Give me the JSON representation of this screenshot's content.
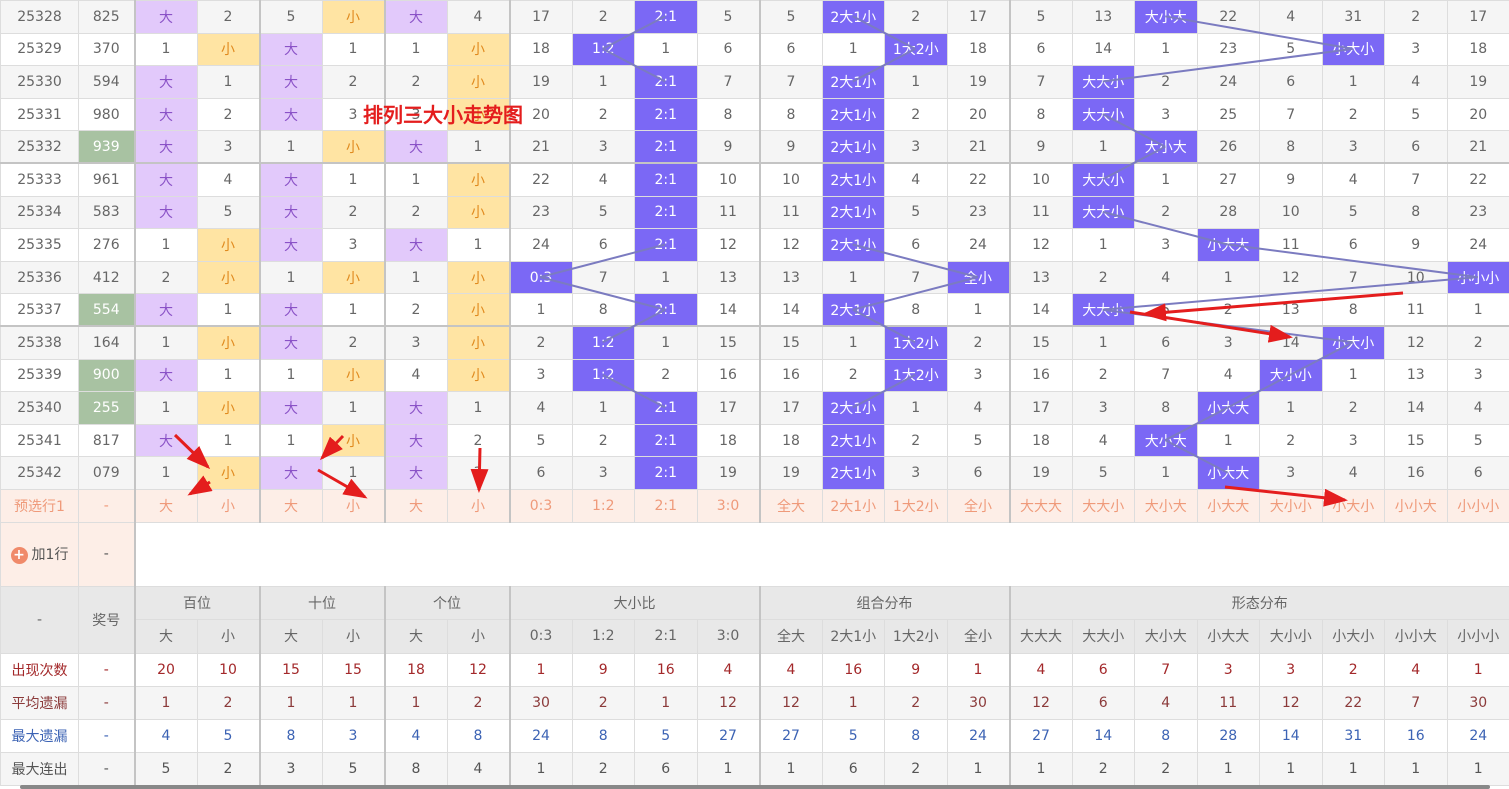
{
  "title_overlay": "排列三大小走势图",
  "colors": {
    "big": "#e2c9fb",
    "small": "#ffe4a3",
    "pattern": "#7b68f5",
    "hot_number": "#a8c2a2",
    "line": "#7b7bc0",
    "arrow": "#e41d1d"
  },
  "rows": [
    {
      "issue": "25328",
      "number": "825",
      "hot": false,
      "cells": [
        "大",
        "2",
        "5",
        "小",
        "大",
        "4",
        "17",
        "2",
        "2:1",
        "5",
        "5",
        "2大1小",
        "2",
        "17",
        "5",
        "13",
        "大小大",
        "22",
        "4",
        "31",
        "2",
        "17"
      ]
    },
    {
      "issue": "25329",
      "number": "370",
      "hot": false,
      "cells": [
        "1",
        "小",
        "大",
        "1",
        "1",
        "小",
        "18",
        "1:2",
        "1",
        "6",
        "6",
        "1",
        "1大2小",
        "18",
        "6",
        "14",
        "1",
        "23",
        "5",
        "小大小",
        "3",
        "18"
      ]
    },
    {
      "issue": "25330",
      "number": "594",
      "hot": false,
      "cells": [
        "大",
        "1",
        "大",
        "2",
        "2",
        "小",
        "19",
        "1",
        "2:1",
        "7",
        "7",
        "2大1小",
        "1",
        "19",
        "7",
        "大大小",
        "2",
        "24",
        "6",
        "1",
        "4",
        "19"
      ]
    },
    {
      "issue": "25331",
      "number": "980",
      "hot": false,
      "cells": [
        "大",
        "2",
        "大",
        "3",
        "3",
        "小",
        "20",
        "2",
        "2:1",
        "8",
        "8",
        "2大1小",
        "2",
        "20",
        "8",
        "大大小",
        "3",
        "25",
        "7",
        "2",
        "5",
        "20"
      ]
    },
    {
      "issue": "25332",
      "number": "939",
      "hot": true,
      "cells": [
        "大",
        "3",
        "1",
        "小",
        "大",
        "1",
        "21",
        "3",
        "2:1",
        "9",
        "9",
        "2大1小",
        "3",
        "21",
        "9",
        "1",
        "大小大",
        "26",
        "8",
        "3",
        "6",
        "21"
      ]
    },
    {
      "issue": "25333",
      "number": "961",
      "hot": false,
      "cells": [
        "大",
        "4",
        "大",
        "1",
        "1",
        "小",
        "22",
        "4",
        "2:1",
        "10",
        "10",
        "2大1小",
        "4",
        "22",
        "10",
        "大大小",
        "1",
        "27",
        "9",
        "4",
        "7",
        "22"
      ]
    },
    {
      "issue": "25334",
      "number": "583",
      "hot": false,
      "cells": [
        "大",
        "5",
        "大",
        "2",
        "2",
        "小",
        "23",
        "5",
        "2:1",
        "11",
        "11",
        "2大1小",
        "5",
        "23",
        "11",
        "大大小",
        "2",
        "28",
        "10",
        "5",
        "8",
        "23"
      ]
    },
    {
      "issue": "25335",
      "number": "276",
      "hot": false,
      "cells": [
        "1",
        "小",
        "大",
        "3",
        "大",
        "1",
        "24",
        "6",
        "2:1",
        "12",
        "12",
        "2大1小",
        "6",
        "24",
        "12",
        "1",
        "3",
        "小大大",
        "11",
        "6",
        "9",
        "24"
      ]
    },
    {
      "issue": "25336",
      "number": "412",
      "hot": false,
      "cells": [
        "2",
        "小",
        "1",
        "小",
        "1",
        "小",
        "0:3",
        "7",
        "1",
        "13",
        "13",
        "1",
        "7",
        "全小",
        "13",
        "2",
        "4",
        "1",
        "12",
        "7",
        "10",
        "小小小"
      ]
    },
    {
      "issue": "25337",
      "number": "554",
      "hot": true,
      "cells": [
        "大",
        "1",
        "大",
        "1",
        "2",
        "小",
        "1",
        "8",
        "2:1",
        "14",
        "14",
        "2大1小",
        "8",
        "1",
        "14",
        "大大小",
        "5",
        "2",
        "13",
        "8",
        "11",
        "1"
      ]
    },
    {
      "issue": "25338",
      "number": "164",
      "hot": false,
      "cells": [
        "1",
        "小",
        "大",
        "2",
        "3",
        "小",
        "2",
        "1:2",
        "1",
        "15",
        "15",
        "1",
        "1大2小",
        "2",
        "15",
        "1",
        "6",
        "3",
        "14",
        "小大小",
        "12",
        "2"
      ]
    },
    {
      "issue": "25339",
      "number": "900",
      "hot": true,
      "cells": [
        "大",
        "1",
        "1",
        "小",
        "4",
        "小",
        "3",
        "1:2",
        "2",
        "16",
        "16",
        "2",
        "1大2小",
        "3",
        "16",
        "2",
        "7",
        "4",
        "大小小",
        "1",
        "13",
        "3"
      ]
    },
    {
      "issue": "25340",
      "number": "255",
      "hot": true,
      "cells": [
        "1",
        "小",
        "大",
        "1",
        "大",
        "1",
        "4",
        "1",
        "2:1",
        "17",
        "17",
        "2大1小",
        "1",
        "4",
        "17",
        "3",
        "8",
        "小大大",
        "1",
        "2",
        "14",
        "4"
      ]
    },
    {
      "issue": "25341",
      "number": "817",
      "hot": false,
      "cells": [
        "大",
        "1",
        "1",
        "小",
        "大",
        "2",
        "5",
        "2",
        "2:1",
        "18",
        "18",
        "2大1小",
        "2",
        "5",
        "18",
        "4",
        "大小大",
        "1",
        "2",
        "3",
        "15",
        "5"
      ]
    },
    {
      "issue": "25342",
      "number": "079",
      "hot": false,
      "cells": [
        "1",
        "小",
        "大",
        "1",
        "大",
        "3",
        "6",
        "3",
        "2:1",
        "19",
        "19",
        "2大1小",
        "3",
        "6",
        "19",
        "5",
        "1",
        "小大大",
        "3",
        "4",
        "16",
        "6"
      ]
    }
  ],
  "preselect": {
    "label": "预选行1",
    "number": "-",
    "cells": [
      "大",
      "小",
      "大",
      "小",
      "大",
      "小",
      "0:3",
      "1:2",
      "2:1",
      "3:0",
      "全大",
      "2大1小",
      "1大2小",
      "全小",
      "大大大",
      "大大小",
      "大小大",
      "小大大",
      "大小小",
      "小大小",
      "小小大",
      "小小小"
    ]
  },
  "add_row": {
    "label": "加1行",
    "number": "-",
    "icon": "plus-circle-icon"
  },
  "header": {
    "corner": "-",
    "number": "奖号",
    "groups": [
      {
        "label": "百位",
        "span": 2
      },
      {
        "label": "十位",
        "span": 2
      },
      {
        "label": "个位",
        "span": 2
      },
      {
        "label": "大小比",
        "span": 4
      },
      {
        "label": "组合分布",
        "span": 4
      },
      {
        "label": "形态分布",
        "span": 8
      }
    ],
    "subs": [
      "大",
      "小",
      "大",
      "小",
      "大",
      "小",
      "0:3",
      "1:2",
      "2:1",
      "3:0",
      "全大",
      "2大1小",
      "1大2小",
      "全小",
      "大大大",
      "大大小",
      "大小大",
      "小大大",
      "大小小",
      "小大小",
      "小小大",
      "小小小"
    ]
  },
  "stats": [
    {
      "label": "出现次数",
      "number": "-",
      "values": [
        "20",
        "10",
        "15",
        "15",
        "18",
        "12",
        "1",
        "9",
        "16",
        "4",
        "4",
        "16",
        "9",
        "1",
        "4",
        "6",
        "7",
        "3",
        "3",
        "2",
        "4",
        "1"
      ]
    },
    {
      "label": "平均遗漏",
      "number": "-",
      "values": [
        "1",
        "2",
        "1",
        "1",
        "1",
        "2",
        "30",
        "2",
        "1",
        "12",
        "12",
        "1",
        "2",
        "30",
        "12",
        "6",
        "4",
        "11",
        "12",
        "22",
        "7",
        "30"
      ]
    },
    {
      "label": "最大遗漏",
      "number": "-",
      "values": [
        "4",
        "5",
        "8",
        "3",
        "4",
        "8",
        "24",
        "8",
        "5",
        "27",
        "27",
        "5",
        "8",
        "24",
        "27",
        "14",
        "8",
        "28",
        "14",
        "31",
        "16",
        "24"
      ]
    },
    {
      "label": "最大连出",
      "number": "-",
      "values": [
        "5",
        "2",
        "3",
        "5",
        "8",
        "4",
        "1",
        "2",
        "6",
        "1",
        "1",
        "6",
        "2",
        "1",
        "1",
        "2",
        "2",
        "1",
        "1",
        "1",
        "1",
        "1"
      ]
    }
  ]
}
